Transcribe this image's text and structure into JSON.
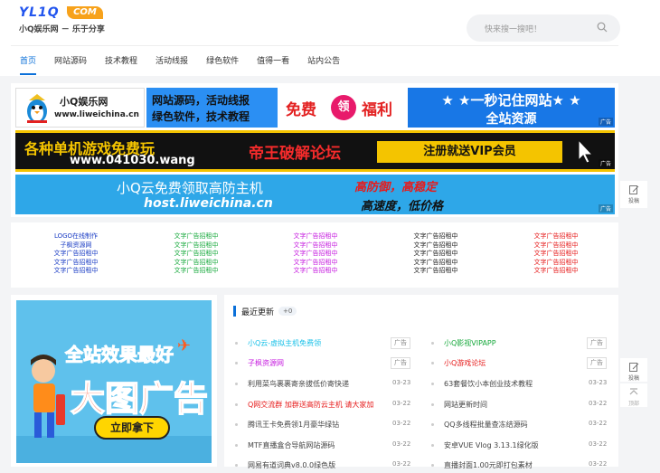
{
  "header": {
    "logo_text": "YL1Q",
    "logo_com": "COM",
    "slogan": "小Q娱乐网 － 乐于分享",
    "search_placeholder": "快来搜一搜吧！"
  },
  "nav": [
    {
      "label": "首页",
      "active": true
    },
    {
      "label": "网站源码"
    },
    {
      "label": "技术教程"
    },
    {
      "label": "活动线报"
    },
    {
      "label": "绿色软件"
    },
    {
      "label": "值得一看"
    },
    {
      "label": "站内公告"
    }
  ],
  "banners": {
    "b1_name": "小Q娱乐网",
    "b1_url": "www.liweichina.cn",
    "b2_line1": "网站源码，活动线报",
    "b2_line2": "绿色软件，技术教程",
    "b3_left": "免费",
    "b3_circle": "领",
    "b3_right": "福利",
    "b4_line1": "★ ★一秒记住网站★ ★",
    "b4_line2": "全站资源",
    "b5_line1": "各种单机游戏免费玩",
    "b5_line2": "www.041030.wang",
    "b5_mid": "帝王破解论坛",
    "b5_btn": "注册就送VIP会员",
    "b6_line1": "小Q云免费领取高防主机",
    "b6_line2": "host.liweichina.cn",
    "b6_right1": "高防御，高稳定",
    "b6_right2": "高速度，低价格",
    "ad_tag": "广告"
  },
  "text_ads": [
    {
      "color": "#1a3cc4",
      "items": [
        "LOGO在线制作",
        "子枫资源网",
        "文字广告招租中",
        "文字广告招租中",
        "文字广告招租中"
      ]
    },
    {
      "color": "#17a93c",
      "items": [
        "文字广告招租中",
        "文字广告招租中",
        "文字广告招租中",
        "文字广告招租中",
        "文字广告招租中"
      ]
    },
    {
      "color": "#c61adf",
      "items": [
        "文字广告招租中",
        "文字广告招租中",
        "文字广告招租中",
        "文字广告招租中",
        "文字广告招租中"
      ]
    },
    {
      "color": "#222222",
      "items": [
        "文字广告招租中",
        "文字广告招租中",
        "文字广告招租中",
        "文字广告招租中",
        "文字广告招租中"
      ]
    },
    {
      "color": "#e61a1a",
      "items": [
        "文字广告招租中",
        "文字广告招租中",
        "文字广告招租中",
        "文字广告招租中",
        "文字广告招租中"
      ]
    }
  ],
  "big_ad": {
    "line1": "全站效果最好",
    "line2": "大图广告",
    "button": "立即拿下"
  },
  "news": {
    "title": "最近更新",
    "count": "+0",
    "left": [
      {
        "title": "小Q云-虚拟主机免费领",
        "meta": "广告",
        "badge": true,
        "color": "#17c0e8"
      },
      {
        "title": "子枫资源网",
        "meta": "广告",
        "badge": true,
        "color": "#c61adf"
      },
      {
        "title": "利用菜鸟裹裹寄亲拔低价寄快递",
        "meta": "03-23",
        "color": "#444"
      },
      {
        "title": "Q网交流群 加群送高防云主机 请大家加",
        "meta": "03-22",
        "color": "#e61a1a"
      },
      {
        "title": "腾讯王卡免费领1月豪华绿钻",
        "meta": "03-22",
        "color": "#444"
      },
      {
        "title": "MTF直播盒合导航网站源码",
        "meta": "03-22",
        "color": "#444"
      },
      {
        "title": "网易有道词典v8.0.0绿色版",
        "meta": "03-22",
        "color": "#444"
      }
    ],
    "right": [
      {
        "title": "小Q影视VIPAPP",
        "meta": "广告",
        "badge": true,
        "color": "#17a93c"
      },
      {
        "title": "小Q游戏论坛",
        "meta": "广告",
        "badge": true,
        "color": "#e61a1a"
      },
      {
        "title": "63套餐饮小本创业技术教程",
        "meta": "03-23",
        "color": "#444"
      },
      {
        "title": "网站更新时间",
        "meta": "03-22",
        "color": "#444"
      },
      {
        "title": "QQ多线程批量查冻结源码",
        "meta": "03-22",
        "color": "#444"
      },
      {
        "title": "安卓VUE Vlog 3.13.1绿化版",
        "meta": "03-22",
        "color": "#444"
      },
      {
        "title": "直播封面1.00元即打包素材",
        "meta": "03-22",
        "color": "#444"
      }
    ]
  },
  "float": {
    "submit1": "投稿",
    "submit2": "投稿",
    "top": "顶部"
  }
}
